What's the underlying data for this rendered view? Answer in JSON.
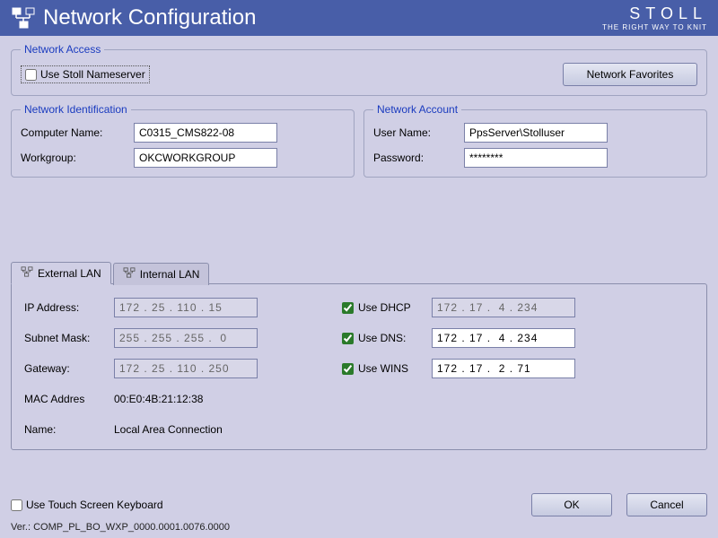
{
  "header": {
    "title": "Network Configuration",
    "brand": "STOLL",
    "tagline": "THE RIGHT WAY TO KNIT"
  },
  "net_access": {
    "legend": "Network Access",
    "use_nameserver_label": "Use Stoll Nameserver",
    "favorites_button": "Network Favorites"
  },
  "net_ident": {
    "legend": "Network Identification",
    "computer_name_label": "Computer Name:",
    "computer_name_value": "C0315_CMS822-08",
    "workgroup_label": "Workgroup:",
    "workgroup_value": "OKCWORKGROUP"
  },
  "net_account": {
    "legend": "Network Account",
    "user_label": "User Name:",
    "user_value": "PpsServer\\Stolluser",
    "password_label": "Password:",
    "password_value": "********"
  },
  "tabs": {
    "external": "External LAN",
    "internal": "Internal LAN"
  },
  "lan": {
    "ip_label": "IP Address:",
    "ip_value": "172 . 25 . 110 . 15",
    "subnet_label": "Subnet Mask:",
    "subnet_value": "255 . 255 . 255 .  0",
    "gateway_label": "Gateway:",
    "gateway_value": "172 . 25 . 110 . 250",
    "mac_label": "MAC Addres",
    "mac_value": "00:E0:4B:21:12:38",
    "name_label": "Name:",
    "name_value": "Local Area Connection",
    "dhcp_label": "Use DHCP",
    "dhcp_value": "172 . 17 .  4 . 234",
    "dns_label": "Use DNS:",
    "dns_value": "172 . 17 .  4 . 234",
    "wins_label": "Use WINS",
    "wins_value": "172 . 17 .  2 . 71"
  },
  "bottom": {
    "touch_kb_label": "Use Touch Screen Keyboard",
    "version": "Ver.: COMP_PL_BO_WXP_0000.0001.0076.0000",
    "ok": "OK",
    "cancel": "Cancel"
  }
}
